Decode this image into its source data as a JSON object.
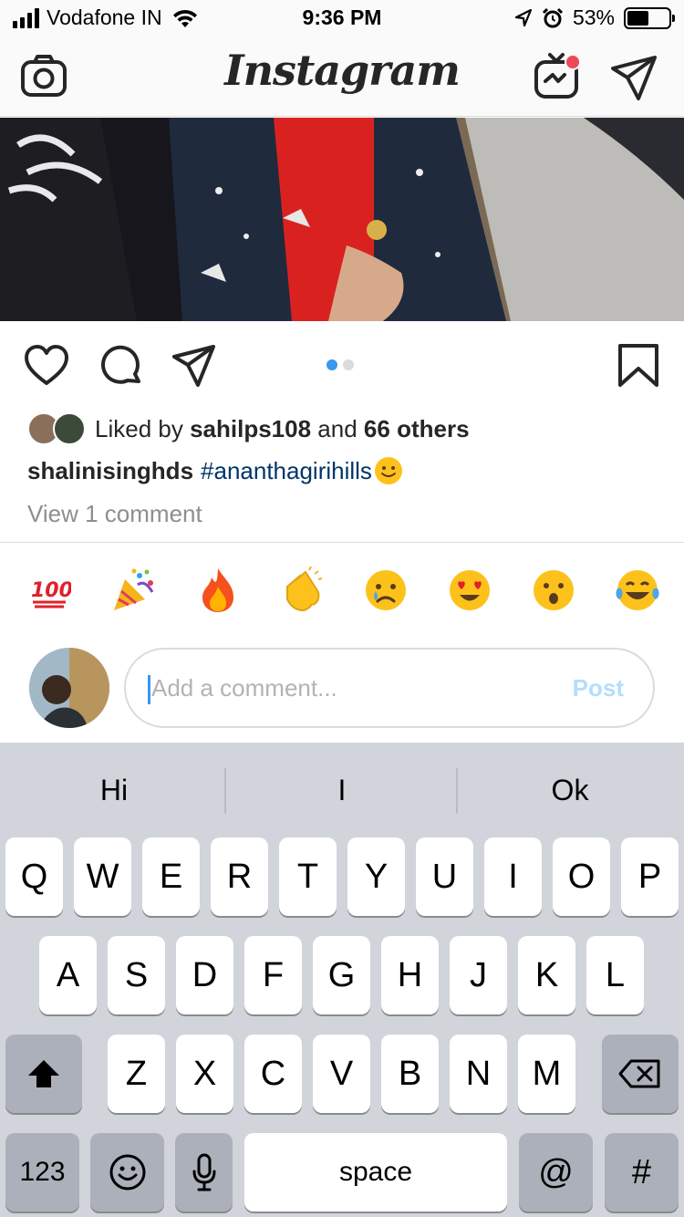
{
  "status_bar": {
    "carrier": "Vodafone IN",
    "time": "9:36 PM",
    "battery_percent": "53%",
    "battery_level": 0.53,
    "icons": [
      "signal-icon",
      "wifi-icon",
      "location-arrow-icon",
      "alarm-icon",
      "battery-icon"
    ]
  },
  "nav": {
    "logo": "Instagram",
    "left_icon": "camera-icon",
    "right_icons": [
      "igtv-icon",
      "direct-message-icon"
    ],
    "igtv_badge_color": "#ed4956"
  },
  "post": {
    "carousel": {
      "current": 1,
      "total": 2
    },
    "likes": {
      "prefix": "Liked by",
      "user": "sahilps108",
      "and": "and",
      "others": "66 others"
    },
    "caption": {
      "username": "shalinisinghds",
      "hashtag": "#ananthagirihills",
      "emoji": "slightly-smiling-face"
    },
    "view_comments": "View 1 comment"
  },
  "quick_emojis": [
    "💯",
    "🎉",
    "🔥",
    "👏",
    "😢",
    "😍",
    "😮",
    "😂"
  ],
  "comment": {
    "placeholder": "Add a comment...",
    "post_label": "Post"
  },
  "keyboard": {
    "suggestions": [
      "Hi",
      "I",
      "Ok"
    ],
    "row1": [
      "Q",
      "W",
      "E",
      "R",
      "T",
      "Y",
      "U",
      "I",
      "O",
      "P"
    ],
    "row2": [
      "A",
      "S",
      "D",
      "F",
      "G",
      "H",
      "J",
      "K",
      "L"
    ],
    "row3": [
      "Z",
      "X",
      "C",
      "V",
      "B",
      "N",
      "M"
    ],
    "numbers_key": "123",
    "space_key": "space",
    "at_key": "@",
    "hash_key": "#"
  },
  "colors": {
    "accent_blue": "#3897f0",
    "hashtag": "#003569",
    "muted": "#8e8e8e",
    "post_disabled": "#b2dffc",
    "keyboard_bg": "#d1d4da"
  }
}
